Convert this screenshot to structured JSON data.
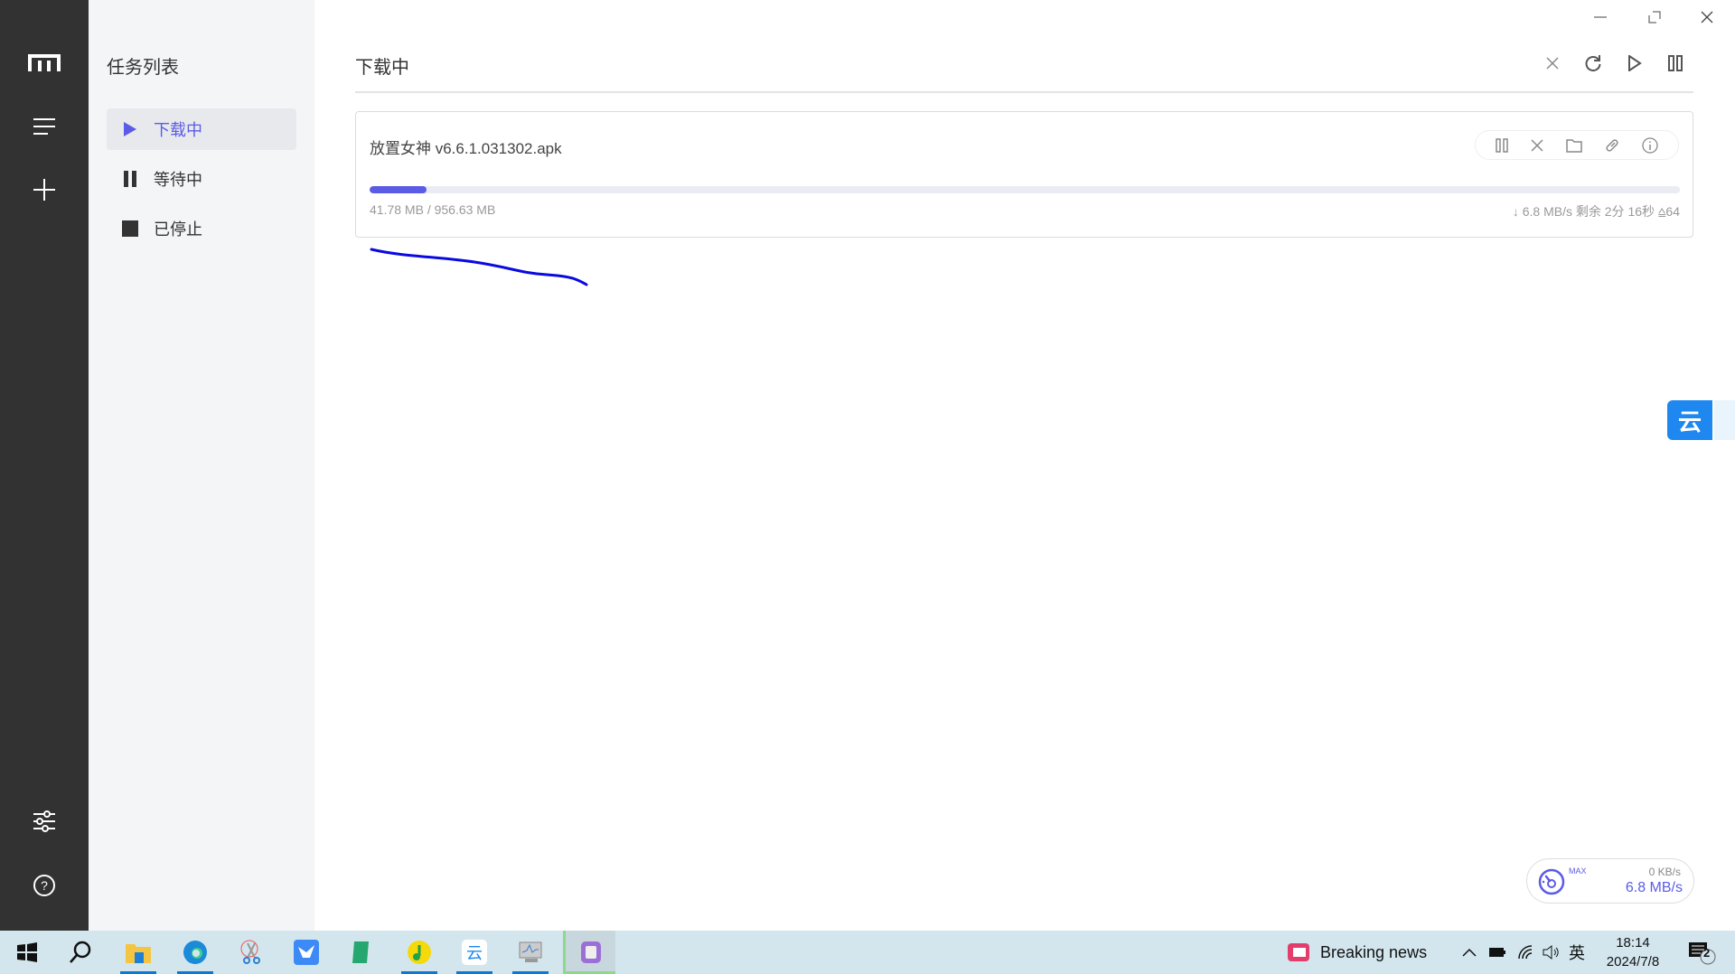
{
  "sidebar": {
    "icons": [
      "logo-icon",
      "menu-icon",
      "add-icon",
      "settings-icon",
      "help-icon"
    ]
  },
  "nav": {
    "title": "任务列表",
    "items": [
      {
        "label": "下载中"
      },
      {
        "label": "等待中"
      },
      {
        "label": "已停止"
      }
    ]
  },
  "main": {
    "title": "下载中"
  },
  "task": {
    "filename": "放置女神 v6.6.1.031302.apk",
    "sizes": "41.78 MB / 956.63 MB",
    "progress_percent": 4.37,
    "speed": "↓ 6.8 MB/s",
    "remaining": "剩余 2分 16秒",
    "connections": "64"
  },
  "speed_widget": {
    "max_label": "MAX",
    "upload": "0 KB/s",
    "download": "6.8 MB/s"
  },
  "taskbar": {
    "news": "Breaking news",
    "ime": "英",
    "time": "18:14",
    "date": "2024/7/8",
    "notifications": "2"
  },
  "colors": {
    "accent": "#5b5ce6",
    "sidebar": "#323232",
    "annotation": "#0a0ae0"
  }
}
